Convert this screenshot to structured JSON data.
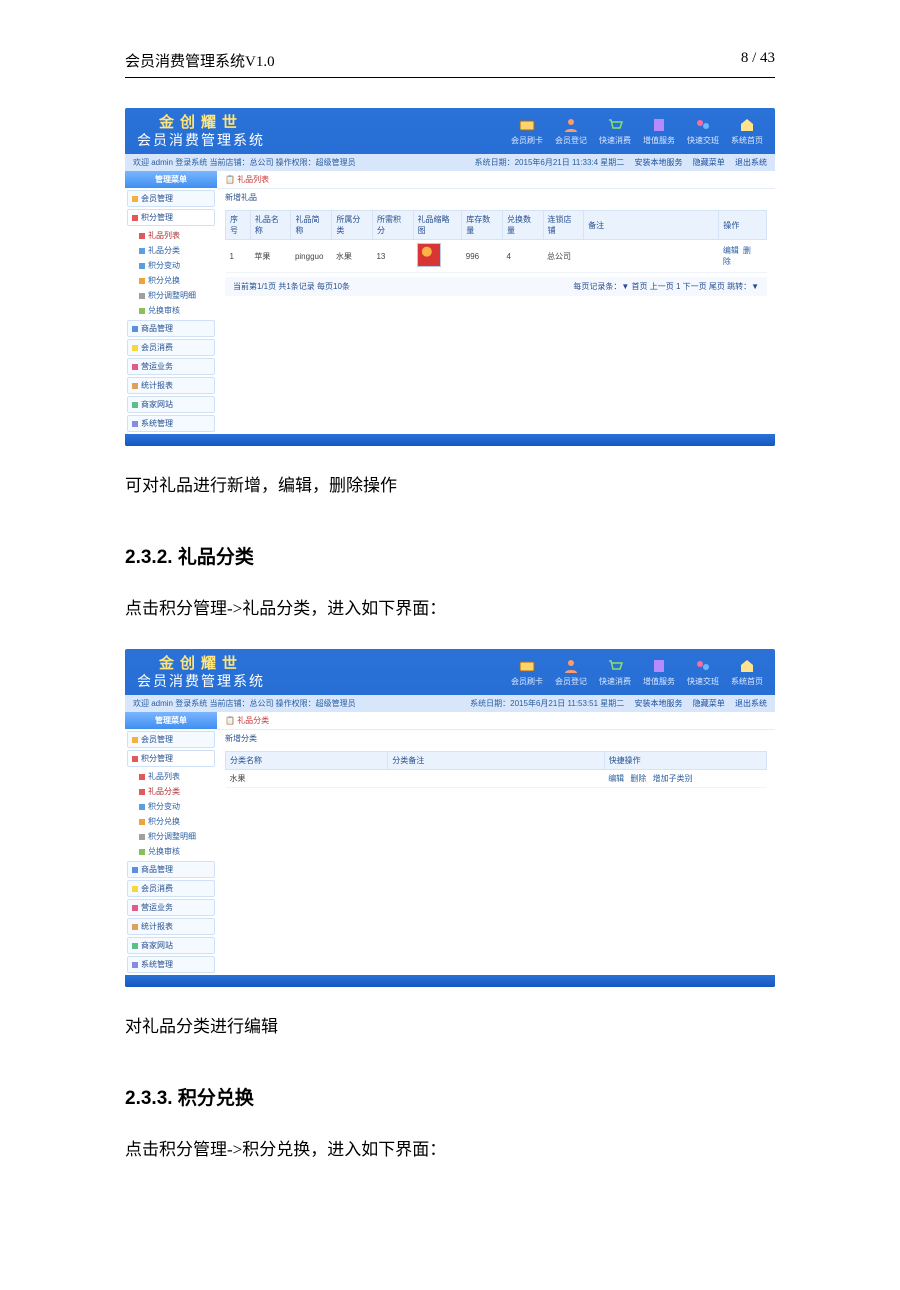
{
  "header": {
    "title": "会员消费管理系统V1.0",
    "page": "8 / 43"
  },
  "text": {
    "below1": "可对礼品进行新增，编辑，删除操作",
    "sec232": "2.3.2. 礼品分类",
    "intro232": "点击积分管理->礼品分类，进入如下界面：",
    "below2": "对礼品分类进行编辑",
    "sec233": "2.3.3. 积分兑换",
    "intro233": "点击积分管理->积分兑换，进入如下界面："
  },
  "app": {
    "brand_top": "金创耀世",
    "brand_sub": "会员消费管理系统",
    "top_icons": [
      "会员刷卡",
      "会员登记",
      "快速消费",
      "增值服务",
      "快速交班",
      "系统首页"
    ],
    "status_left": "欢迎 admin 登录系统 当前店铺：总公司  操作权限：超级管理员",
    "status_date1": "系统日期：2015年6月21日 11:33:4 星期二",
    "status_date2": "系统日期：2015年6月21日 11:53:51 星期二",
    "status_links": [
      "安装本地服务",
      "隐藏菜单",
      "退出系统"
    ],
    "side_header": "管理菜单",
    "groups": [
      "会员管理",
      "积分管理",
      "商品管理",
      "会员消费",
      "营运业务",
      "统计报表",
      "商家网站",
      "系统管理"
    ],
    "subs": [
      "礼品列表",
      "礼品分类",
      "积分变动",
      "积分兑换",
      "积分调整明细",
      "兑换审核"
    ]
  },
  "shot1": {
    "crumb": "礼品列表",
    "toolbar": "新增礼品",
    "headers": [
      "序号",
      "礼品名称",
      "礼品简称",
      "所属分类",
      "所需积分",
      "礼品缩略图",
      "库存数量",
      "兑换数量",
      "连锁店铺",
      "备注",
      "操作"
    ],
    "row": {
      "idx": "1",
      "name": "苹果",
      "short": "pingguo",
      "cat": "水果",
      "points": "13",
      "stock": "996",
      "count": "4",
      "shop": "总公司",
      "note": "",
      "ops": [
        "编辑",
        "删除"
      ]
    },
    "pager_left": "当前第1/1页 共1条记录 每页10条",
    "pager_right": "每页记录条：▼  首页 上一页 1 下一页 尾页 跳转：▼"
  },
  "shot2": {
    "crumb": "礼品分类",
    "toolbar": "新增分类",
    "headers": [
      "分类名称",
      "分类备注",
      "快捷操作"
    ],
    "row": {
      "name": "水果",
      "note": "",
      "ops": [
        "编辑",
        "删除",
        "增加子类别"
      ]
    }
  }
}
